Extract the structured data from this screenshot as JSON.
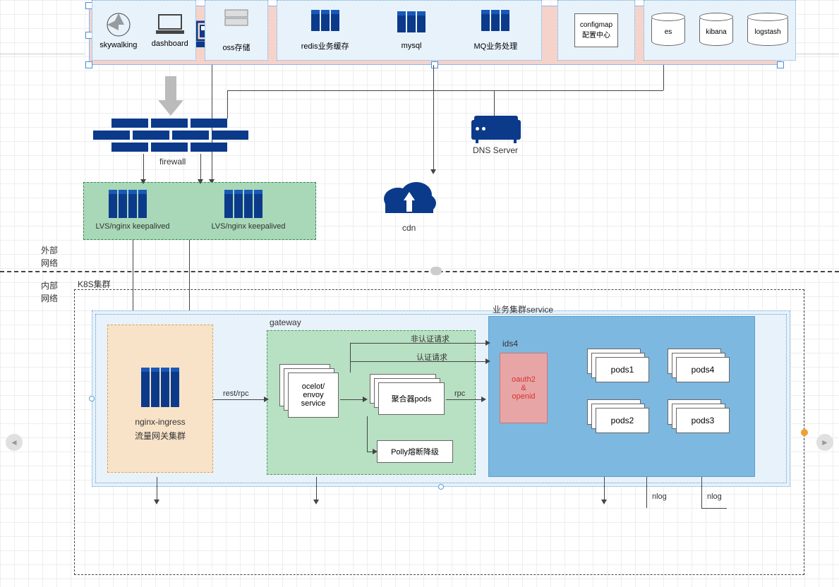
{
  "labels": {
    "external_net1": "外部",
    "external_net2": "网络",
    "internal_net1": "内部",
    "internal_net2": "网络",
    "k8s_cluster": "K8S集群",
    "firewall": "firewall",
    "dns": "DNS Server",
    "cdn": "cdn",
    "lvs1": "LVS/nginx keepalived",
    "lvs2": "LVS/nginx keepalived",
    "nginx_ingress1": "nginx-ingress",
    "nginx_ingress2": "流量网关集群",
    "gateway": "gateway",
    "service_cluster": "业务集群service",
    "rest_rpc": "rest/rpc",
    "unauth_req": "非认证请求",
    "auth_req": "认证请求",
    "rpc": "rpc",
    "ocelot1": "ocelot/",
    "ocelot2": "envoy",
    "ocelot3": "service",
    "aggregator": "聚合器pods",
    "polly": "Polly熔断降级",
    "ids4": "ids4",
    "oauth1": "oauth2",
    "oauth2": "&",
    "oauth3": "openid",
    "pods1": "pods1",
    "pods2": "pods2",
    "pods3": "pods3",
    "pods4": "pods4",
    "nlog": "nlog",
    "skywalking": "skywalking",
    "dashboard": "dashboard",
    "oss": "oss存储",
    "redis": "redis业务缓存",
    "mysql": "mysql",
    "mq": "MQ业务处理",
    "configmap1": "configmap",
    "configmap2": "配置中心",
    "es": "es",
    "kibana": "kibana",
    "logstash": "logstash"
  },
  "colors": {
    "navy": "#0b3a8a",
    "client_bg": "#f5d3cb",
    "lb_bg": "#a8d8b8",
    "k8s_soft": "#e8f2fa",
    "ingress_bg": "#f8e3c8",
    "gateway_bg": "#b8e0c2",
    "service_bg": "#7db8e0",
    "ids4_bg": "#e8a5a5"
  }
}
